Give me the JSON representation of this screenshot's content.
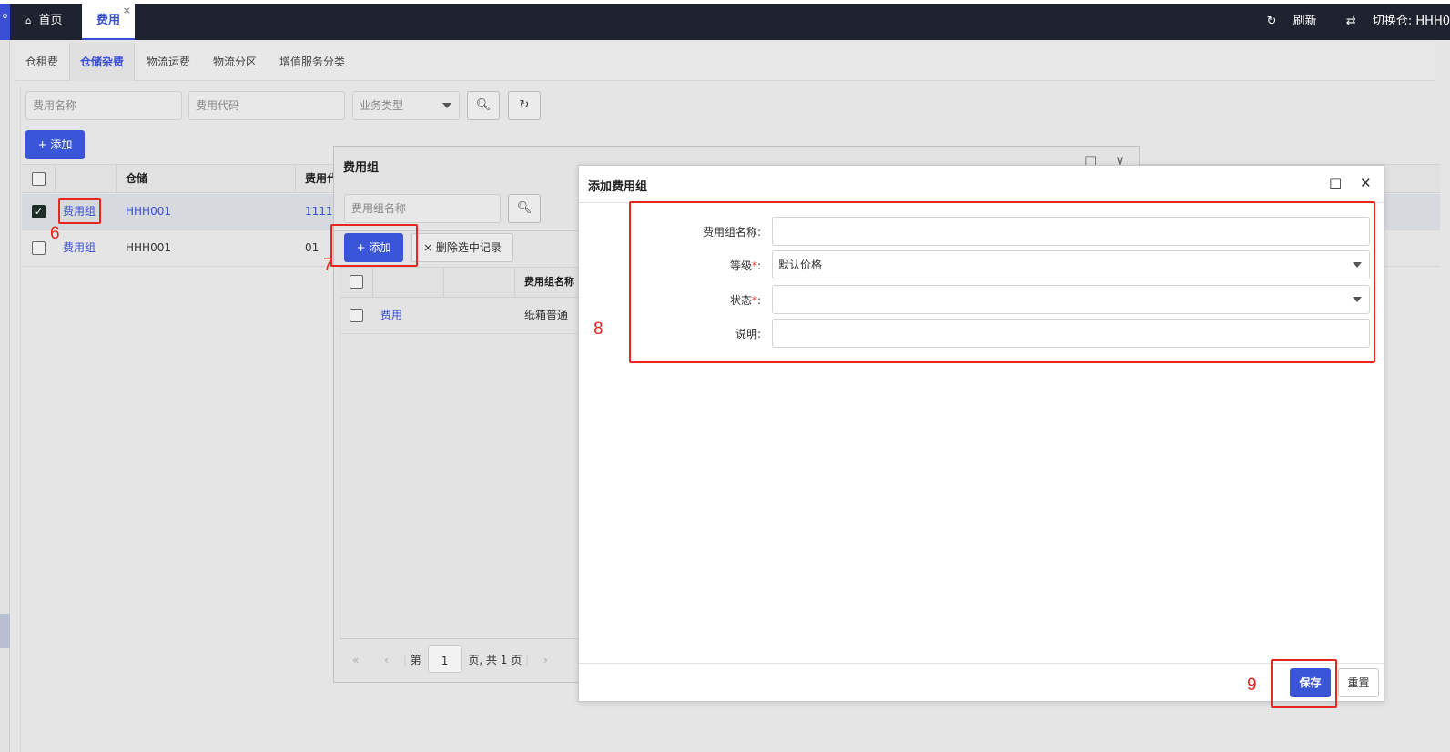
{
  "topbar": {
    "left_strip_glyph": "o",
    "home_tab": "首页",
    "fee_tab": "费用",
    "refresh": "刷新",
    "switch_warehouse": "切换仓: HHH0"
  },
  "subtabs": [
    "仓租费",
    "仓储杂费",
    "物流运费",
    "物流分区",
    "增值服务分类"
  ],
  "filters": {
    "fee_name_placeholder": "费用名称",
    "fee_code_placeholder": "费用代码",
    "business_type_placeholder": "业务类型"
  },
  "main_add_label": "+ 添加",
  "main_table": {
    "headers": [
      "仓储",
      "费用代"
    ],
    "rows": [
      {
        "action": "费用组",
        "warehouse": "HHH001",
        "code": "1111",
        "checked": true
      },
      {
        "action": "费用组",
        "warehouse": "HHH001",
        "code": "01",
        "checked": false
      }
    ]
  },
  "modal1": {
    "title": "费用组",
    "search_placeholder": "费用组名称",
    "add_label": "+ 添加",
    "delete_label": "× 删除选中记录",
    "header_name": "费用组名称",
    "row": {
      "action": "费用",
      "name": "纸箱普通"
    },
    "pager": {
      "prefix": "第",
      "page": "1",
      "suffix": "页, 共 1 页"
    }
  },
  "modal2": {
    "title": "添加费用组",
    "fields": {
      "name_label": "费用组名称:",
      "level_label": "等级",
      "level_value": "默认价格",
      "status_label": "状态",
      "desc_label": "说明:",
      "required_mark": "*",
      "colon": ":"
    },
    "save_label": "保存",
    "reset_label": "重置"
  },
  "annotations": [
    "6",
    "7",
    "8",
    "9"
  ],
  "colors": {
    "accent": "#3b55d9",
    "annotation": "#e8251f",
    "topbar": "#1f2330"
  }
}
